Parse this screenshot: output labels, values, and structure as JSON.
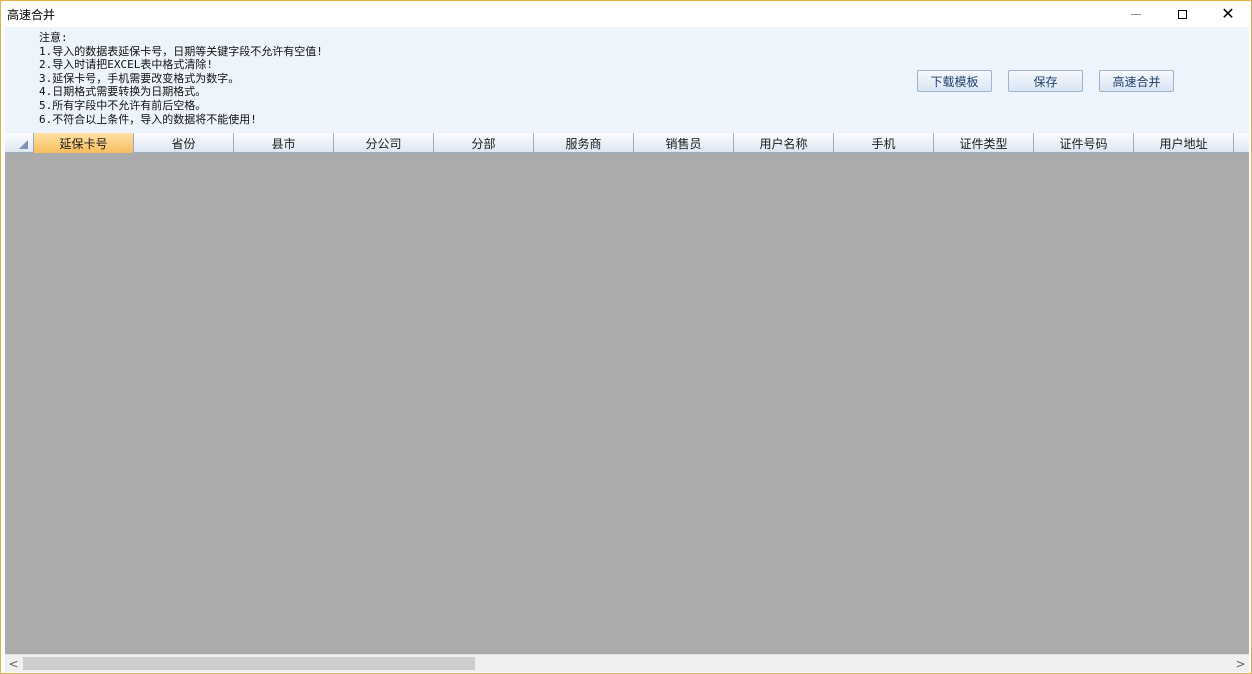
{
  "window": {
    "title": "高速合并",
    "min_label": "",
    "close_glyph": "✕"
  },
  "notice": {
    "lines": [
      "注意:",
      "1.导入的数据表延保卡号，日期等关键字段不允许有空值!",
      "2.导入时请把EXCEL表中格式清除!",
      "3.延保卡号，手机需要改变格式为数字。",
      "4.日期格式需要转换为日期格式。",
      "5.所有字段中不允许有前后空格。",
      "6.不符合以上条件，导入的数据将不能使用!"
    ]
  },
  "toolbar": {
    "download_template": "下载模板",
    "save": "保存",
    "merge": "高速合并"
  },
  "grid": {
    "columns": [
      "延保卡号",
      "省份",
      "县市",
      "分公司",
      "分部",
      "服务商",
      "销售员",
      "用户名称",
      "手机",
      "证件类型",
      "证件号码",
      "用户地址"
    ],
    "active_column": "延保卡号"
  },
  "scrollbar": {
    "left_arrow": "<",
    "right_arrow": ">"
  },
  "colors": {
    "accent_border": "#e8b04a",
    "grid_background": "#ababab",
    "active_header": "#f6bd5d",
    "notice_background": "#eef4fb"
  }
}
